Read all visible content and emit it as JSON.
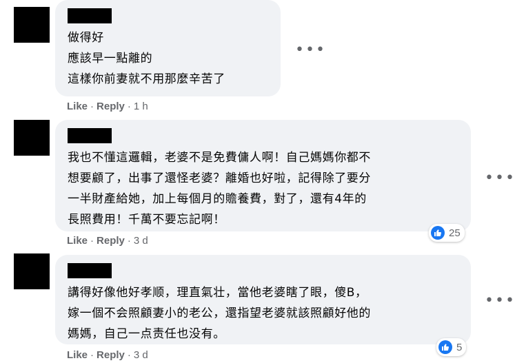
{
  "comments": [
    {
      "lines": "做得好\n應該早一點離的\n這樣你前妻就不用那麼辛苦了",
      "like": "Like",
      "reply": "Reply",
      "time": "1 h"
    },
    {
      "lines": "我也不懂這邏輯，老婆不是免費傭人啊！自己媽媽你都不\n想要顧了，出事了還怪老婆？離婚也好啦，記得除了要分\n一半財產給她，加上每個月的贍養費，對了，還有4年的\n長照費用！千萬不要忘記啊！",
      "like": "Like",
      "reply": "Reply",
      "time": "3 d",
      "reaction_count": "25"
    },
    {
      "lines": "講得好像他好孝顺，理直氣壮，當他老婆瞎了眼，傻B，\n嫁一個不会照顧妻小的老公，還指望老婆就該照顧好他的\n媽媽，自己一点责任也没有。",
      "like": "Like",
      "reply": "Reply",
      "time": "3 d",
      "reaction_count": "5"
    }
  ],
  "colors": {
    "bubble": "#f0f2f5",
    "meta": "#65676b",
    "like_blue": "#1877f2"
  },
  "icons": {
    "more": "more-horizontal-icon",
    "reaction": "thumbs-up-icon"
  }
}
